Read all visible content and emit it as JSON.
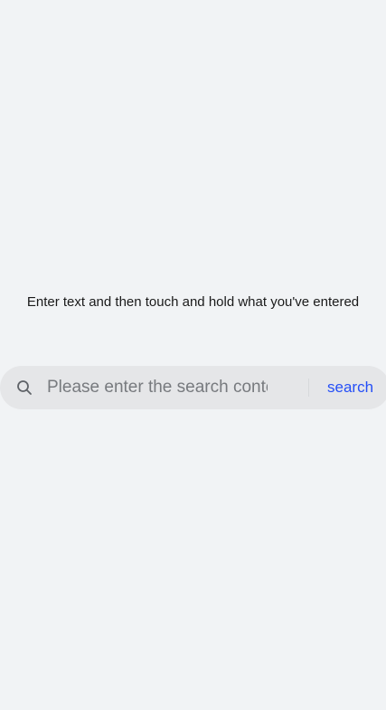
{
  "instruction": {
    "text": "Enter text and then touch and hold what you've entered"
  },
  "search": {
    "placeholder": "Please enter the search content",
    "value": "",
    "icon": "search-icon",
    "button_label": "search",
    "button_color": "#254ff7"
  },
  "colors": {
    "background": "#f1f3f5",
    "search_bar": "#e5e6e8"
  }
}
